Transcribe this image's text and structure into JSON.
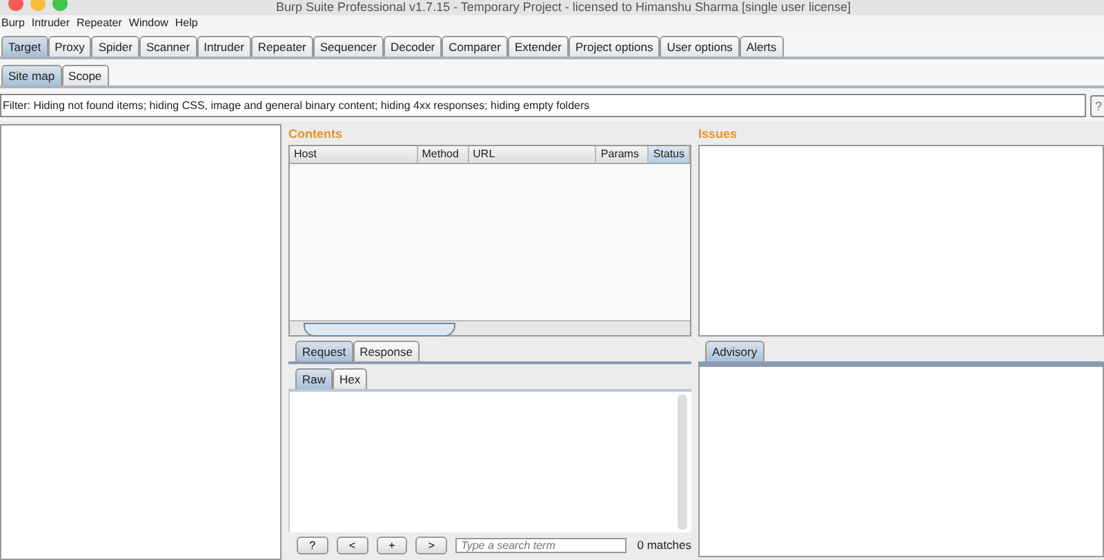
{
  "window": {
    "title": "Burp Suite Professional v1.7.15 - Temporary Project - licensed to Himanshu Sharma [single user license]"
  },
  "menu": [
    "Burp",
    "Intruder",
    "Repeater",
    "Window",
    "Help"
  ],
  "tabs": [
    {
      "label": "Target",
      "selected": true
    },
    {
      "label": "Proxy",
      "selected": false
    },
    {
      "label": "Spider",
      "selected": false
    },
    {
      "label": "Scanner",
      "selected": false
    },
    {
      "label": "Intruder",
      "selected": false
    },
    {
      "label": "Repeater",
      "selected": false
    },
    {
      "label": "Sequencer",
      "selected": false
    },
    {
      "label": "Decoder",
      "selected": false
    },
    {
      "label": "Comparer",
      "selected": false
    },
    {
      "label": "Extender",
      "selected": false
    },
    {
      "label": "Project options",
      "selected": false
    },
    {
      "label": "User options",
      "selected": false
    },
    {
      "label": "Alerts",
      "selected": false
    }
  ],
  "subtabs": [
    {
      "label": "Site map",
      "selected": true
    },
    {
      "label": "Scope",
      "selected": false
    }
  ],
  "filter": {
    "text": "Filter:  Hiding not found items;  hiding CSS, image and general binary content;  hiding 4xx responses;  hiding empty folders",
    "help": "?"
  },
  "contents": {
    "title": "Contents",
    "columns": [
      {
        "label": "Host",
        "sorted": false
      },
      {
        "label": "Method",
        "sorted": false
      },
      {
        "label": "URL",
        "sorted": false
      },
      {
        "label": "Params",
        "sorted": false
      },
      {
        "label": "Status",
        "sorted": true
      }
    ]
  },
  "issues": {
    "title": "Issues"
  },
  "message_tabs": [
    {
      "label": "Request",
      "selected": true
    },
    {
      "label": "Response",
      "selected": false
    }
  ],
  "view_tabs": [
    {
      "label": "Raw",
      "selected": true
    },
    {
      "label": "Hex",
      "selected": false
    }
  ],
  "search_bar": {
    "buttons": [
      "?",
      "<",
      "+",
      ">"
    ],
    "placeholder": "Type a search term",
    "matches": "0 matches"
  },
  "advisory_tabs": [
    {
      "label": "Advisory",
      "selected": true
    }
  ]
}
